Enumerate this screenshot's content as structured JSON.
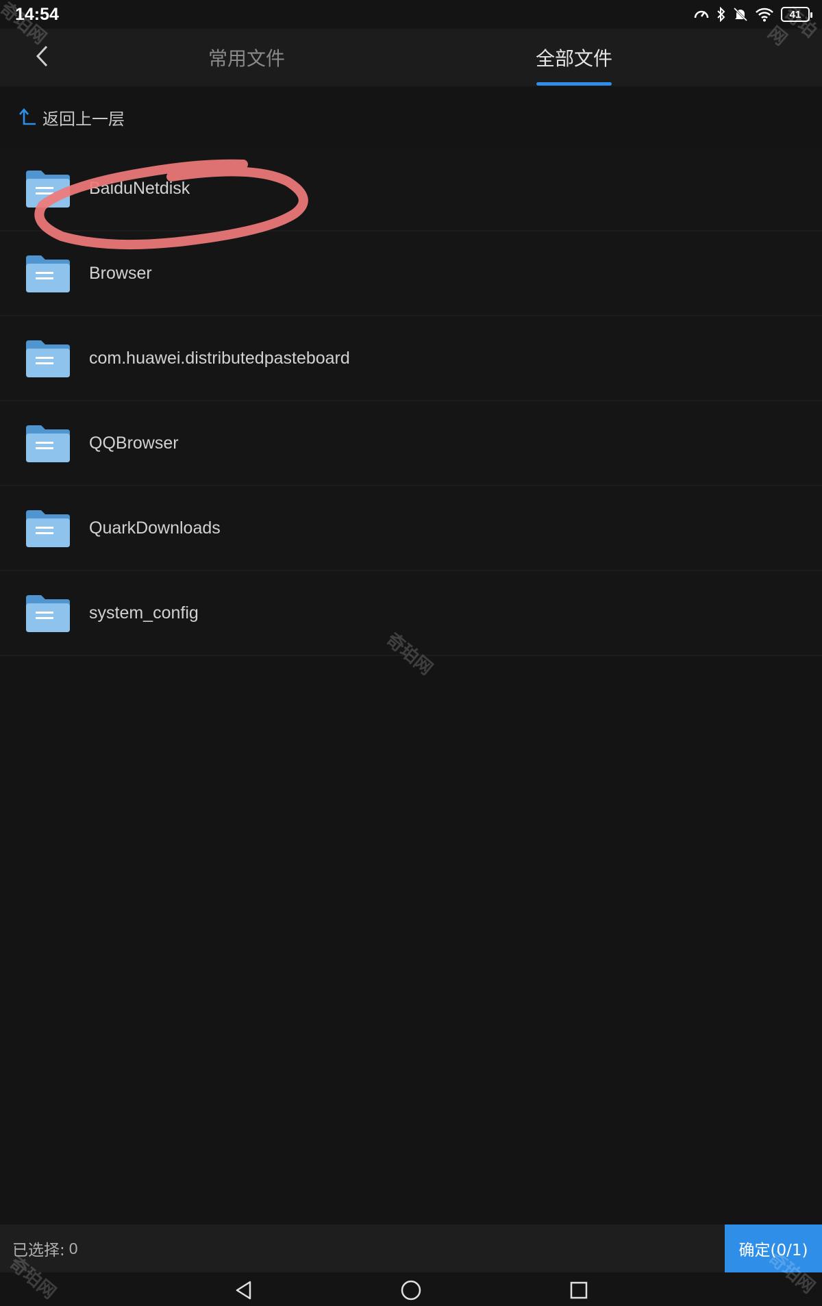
{
  "status_bar": {
    "time": "14:54",
    "battery": "41",
    "icons": [
      "speed-icon",
      "bluetooth-icon",
      "mute-bell-icon",
      "wifi-icon",
      "battery-icon"
    ]
  },
  "header": {
    "tabs": [
      {
        "label": "常用文件",
        "active": false
      },
      {
        "label": "全部文件",
        "active": true
      }
    ],
    "accent_color": "#2f8ee8"
  },
  "navigation": {
    "up_level_label": "返回上一层"
  },
  "files": [
    {
      "name": "BaiduNetdisk",
      "type": "folder"
    },
    {
      "name": "Browser",
      "type": "folder"
    },
    {
      "name": "com.huawei.distributedpasteboard",
      "type": "folder"
    },
    {
      "name": "QQBrowser",
      "type": "folder"
    },
    {
      "name": "QuarkDownloads",
      "type": "folder"
    },
    {
      "name": "system_config",
      "type": "folder"
    }
  ],
  "footer": {
    "selected_label": "已选择:",
    "selected_count": "0",
    "confirm_label": "确定(0/1)"
  },
  "watermark_text": "奇珀网"
}
